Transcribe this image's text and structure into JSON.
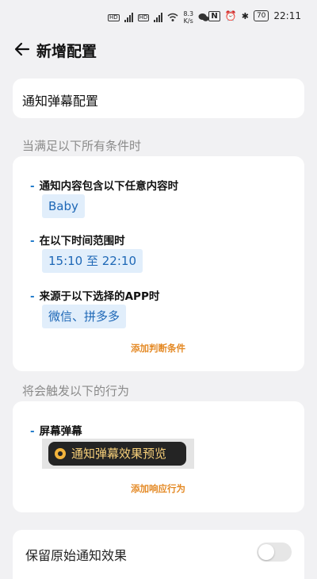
{
  "status_bar": {
    "network_1": "HD",
    "network_2": "HD",
    "speed_value": "8.3",
    "speed_unit": "K/s",
    "battery": "70",
    "time": "22:11"
  },
  "header": {
    "title": "新增配置"
  },
  "config_name": "通知弹幕配置",
  "conditions_section_label": "当满足以下所有条件时",
  "conditions": [
    {
      "title": "通知内容包含以下任意内容时",
      "value": "Baby"
    },
    {
      "title": "在以下时间范围时",
      "value": "15:10 至 22:10"
    },
    {
      "title": "来源于以下选择的APP时",
      "value": "微信、拼多多"
    }
  ],
  "add_condition_label": "添加判断条件",
  "actions_section_label": "将会触发以下的行为",
  "action": {
    "title": "屏幕弹幕",
    "preview_text": "通知弹幕效果预览"
  },
  "add_action_label": "添加响应行为",
  "keep_original": {
    "label": "保留原始通知效果",
    "enabled": false
  },
  "colors": {
    "accent": "#1a77c9",
    "link": "#e48a26",
    "chip_bg": "#e1eefb"
  }
}
